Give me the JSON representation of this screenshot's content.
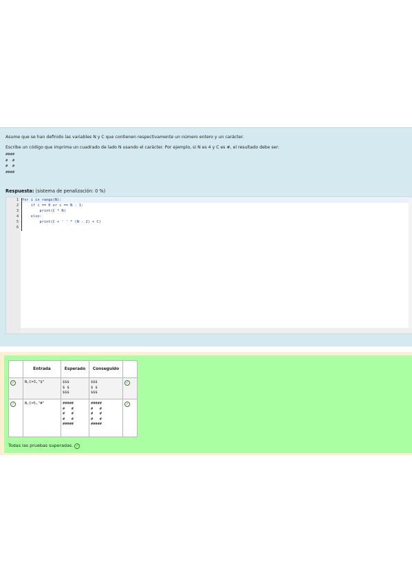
{
  "question": {
    "line1": "Asume que se han definido las variables N y C que contienen respectivamente un número entero y un carácter.",
    "line2": "Escribe un código que imprima un cuadrado de lado N usando el carácter. Por ejemplo, si N es 4 y C es #, el resultado debe ser:",
    "sample_output": [
      "####",
      "#  #",
      "#  #",
      "####"
    ]
  },
  "answer": {
    "label": "Respuesta:",
    "penalty": "(sistema de penalización: 0 %)",
    "line_numbers": [
      "1",
      "2",
      "3",
      "4",
      "5",
      "6"
    ],
    "code_lines": [
      "for i in range(N):",
      "    if i == 0 or i == N - 1:",
      "        print(C * N)",
      "    else:",
      "        print(C + ' ' * (N - 2) + C)",
      ""
    ]
  },
  "results": {
    "headers": [
      "Entrada",
      "Esperado",
      "Conseguido"
    ],
    "rows": [
      {
        "input": "N,C=3,\"$\"",
        "expected": "$$$\n$ $\n$$$",
        "got": "$$$\n$ $\n$$$"
      },
      {
        "input": "N,C=5,\"#\"",
        "expected": "#####\n#   #\n#   #\n#   #\n#####",
        "got": "#####\n#   #\n#   #\n#   #\n#####"
      }
    ],
    "status_icon": "check-circle-icon",
    "summary": "Todas las pruebas superadas."
  },
  "colors": {
    "question_bg": "#d4eaf0",
    "feedback_outer_bg": "#fdf0d2",
    "feedback_inner_bg": "#aaffa3",
    "check_color": "#3a7d28"
  }
}
